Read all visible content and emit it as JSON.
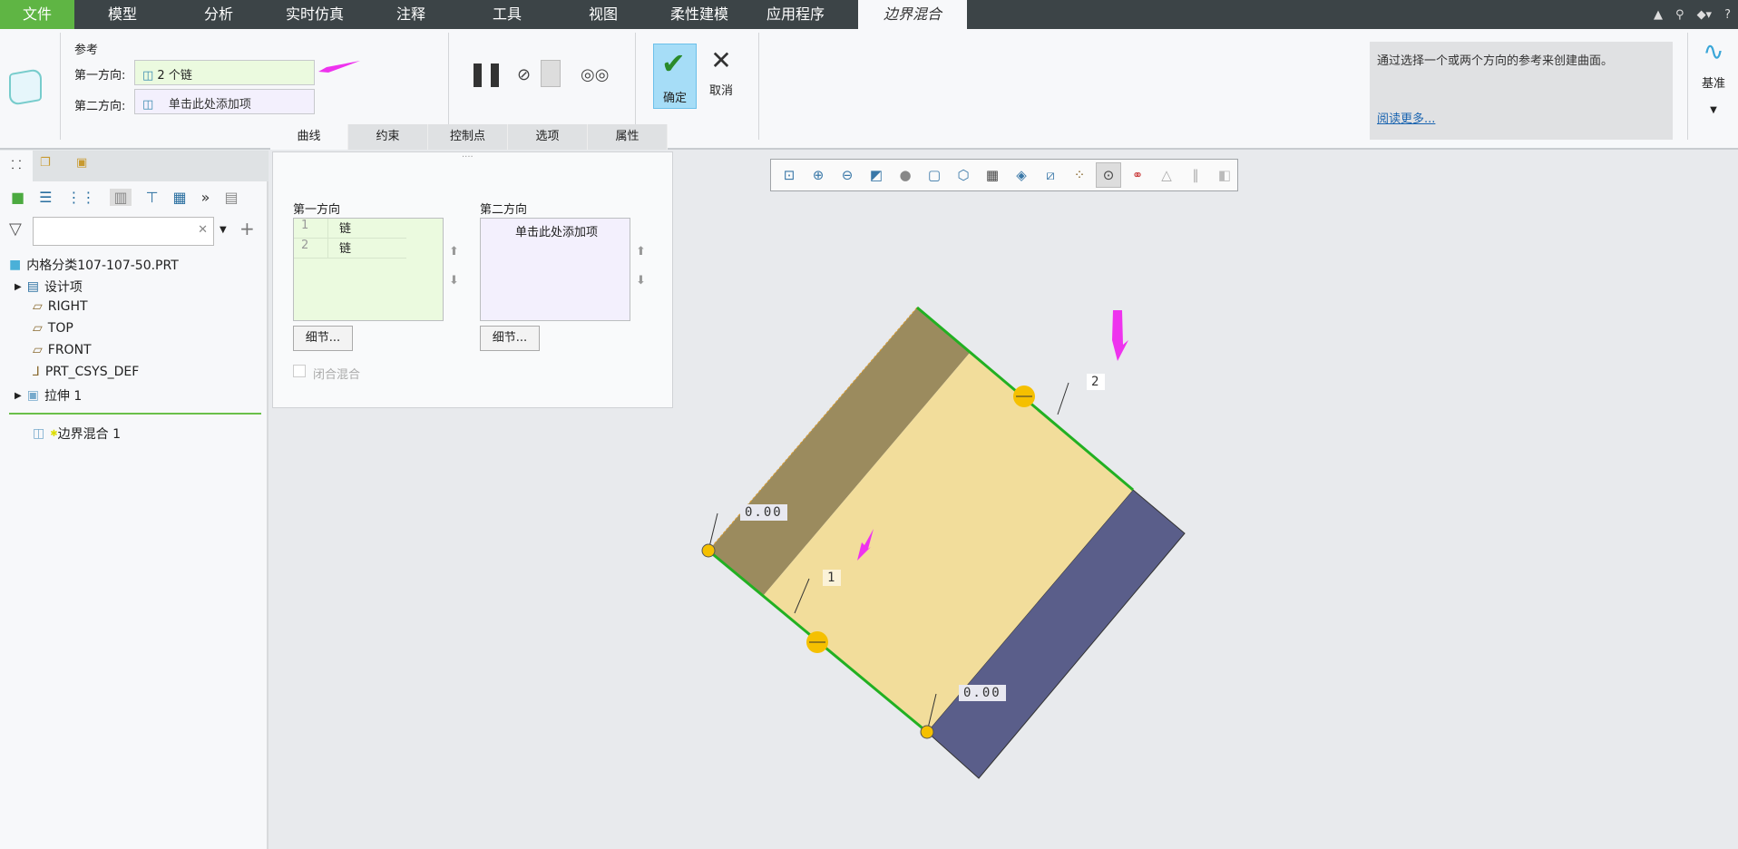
{
  "menu": {
    "tabs": [
      "文件",
      "模型",
      "分析",
      "实时仿真",
      "注释",
      "工具",
      "视图",
      "柔性建模",
      "应用程序"
    ],
    "active_tab": "边界混合"
  },
  "ribbon": {
    "group_label": "参考",
    "dir1_label": "第一方向:",
    "dir1_value": "2 个链",
    "dir2_label": "第二方向:",
    "dir2_value": "单击此处添加项",
    "ok": "确定",
    "cancel": "取消",
    "tabs": [
      "曲线",
      "约束",
      "控制点",
      "选项",
      "属性"
    ],
    "help_text": "通过选择一个或两个方向的参考来创建曲面。",
    "help_link": "阅读更多...",
    "datum": "基准"
  },
  "tree": {
    "root": "内格分类107-107-50.PRT",
    "items": [
      "设计项",
      "RIGHT",
      "TOP",
      "FRONT",
      "PRT_CSYS_DEF",
      "拉伸 1"
    ],
    "new_feature": "边界混合 1"
  },
  "panel": {
    "dir1_title": "第一方向",
    "dir2_title": "第二方向",
    "dir1_rows": [
      {
        "n": "1",
        "v": "链"
      },
      {
        "n": "2",
        "v": "链"
      }
    ],
    "dir2_placeholder": "单击此处添加项",
    "details": "细节...",
    "closed_blend": "闭合混合"
  },
  "viewport": {
    "dims": [
      "0.00",
      "0.00"
    ],
    "chain_labels": [
      "1",
      "2"
    ]
  },
  "colors": {
    "accent_green": "#5fb544",
    "face_tan": "#f2dd9b",
    "face_olive": "#9b8b5e",
    "face_side": "#5a5e8a",
    "edge": "#22b022",
    "handle": "#f5c000",
    "arrow": "#ee33ee"
  }
}
